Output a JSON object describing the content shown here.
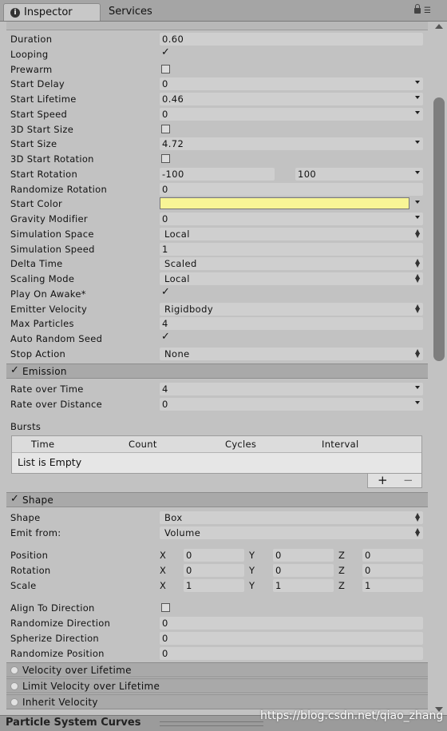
{
  "tabs": [
    {
      "label": "Inspector"
    },
    {
      "label": "Services"
    }
  ],
  "icons": {
    "info": "info-icon",
    "lock": "lock-icon",
    "menu": "context-menu-icon"
  },
  "colors": {
    "start_color": "#f8f596",
    "section_bg": "#a9a9a9",
    "panel_bg": "#c2c2c2"
  },
  "main": {
    "duration": {
      "label": "Duration",
      "value": "0.60"
    },
    "looping": {
      "label": "Looping",
      "checked": true
    },
    "prewarm": {
      "label": "Prewarm",
      "checked": false
    },
    "start_delay": {
      "label": "Start Delay",
      "value": "0"
    },
    "start_lifetime": {
      "label": "Start Lifetime",
      "value": "0.46"
    },
    "start_speed": {
      "label": "Start Speed",
      "value": "0"
    },
    "start_size_3d": {
      "label": "3D Start Size",
      "checked": false
    },
    "start_size": {
      "label": "Start Size",
      "value": "4.72"
    },
    "start_rotation_3d": {
      "label": "3D Start Rotation",
      "checked": false
    },
    "start_rotation": {
      "label": "Start Rotation",
      "min": "-100",
      "max": "100"
    },
    "randomize_rotation": {
      "label": "Randomize Rotation",
      "value": "0"
    },
    "start_color": {
      "label": "Start Color"
    },
    "gravity_modifier": {
      "label": "Gravity Modifier",
      "value": "0"
    },
    "simulation_space": {
      "label": "Simulation Space",
      "value": "Local"
    },
    "simulation_speed": {
      "label": "Simulation Speed",
      "value": "1"
    },
    "delta_time": {
      "label": "Delta Time",
      "value": "Scaled"
    },
    "scaling_mode": {
      "label": "Scaling Mode",
      "value": "Local"
    },
    "play_on_awake": {
      "label": "Play On Awake*",
      "checked": true
    },
    "emitter_velocity": {
      "label": "Emitter Velocity",
      "value": "Rigidbody"
    },
    "max_particles": {
      "label": "Max Particles",
      "value": "4"
    },
    "auto_random_seed": {
      "label": "Auto Random Seed",
      "checked": true
    },
    "stop_action": {
      "label": "Stop Action",
      "value": "None"
    }
  },
  "emission": {
    "title": "Emission",
    "rate_over_time": {
      "label": "Rate over Time",
      "value": "4"
    },
    "rate_over_distance": {
      "label": "Rate over Distance",
      "value": "0"
    },
    "bursts_label": "Bursts",
    "bursts_columns": [
      "Time",
      "Count",
      "Cycles",
      "Interval"
    ],
    "bursts_empty": "List is Empty",
    "add_symbol": "+",
    "remove_symbol": "−"
  },
  "shape": {
    "title": "Shape",
    "shape": {
      "label": "Shape",
      "value": "Box"
    },
    "emit_from": {
      "label": "Emit from:",
      "value": "Volume"
    },
    "position": {
      "label": "Position",
      "x": "0",
      "y": "0",
      "z": "0"
    },
    "rotation": {
      "label": "Rotation",
      "x": "0",
      "y": "0",
      "z": "0"
    },
    "scale": {
      "label": "Scale",
      "x": "1",
      "y": "1",
      "z": "1"
    },
    "axes": {
      "x": "X",
      "y": "Y",
      "z": "Z"
    },
    "align_to_direction": {
      "label": "Align To Direction",
      "checked": false
    },
    "randomize_direction": {
      "label": "Randomize Direction",
      "value": "0"
    },
    "spherize_direction": {
      "label": "Spherize Direction",
      "value": "0"
    },
    "randomize_position": {
      "label": "Randomize Position",
      "value": "0"
    }
  },
  "modules": [
    {
      "title": "Velocity over Lifetime"
    },
    {
      "title": "Limit Velocity over Lifetime"
    },
    {
      "title": "Inherit Velocity"
    }
  ],
  "footer": {
    "title": "Particle System Curves",
    "watermark": "https://blog.csdn.net/qiao_zhang"
  }
}
